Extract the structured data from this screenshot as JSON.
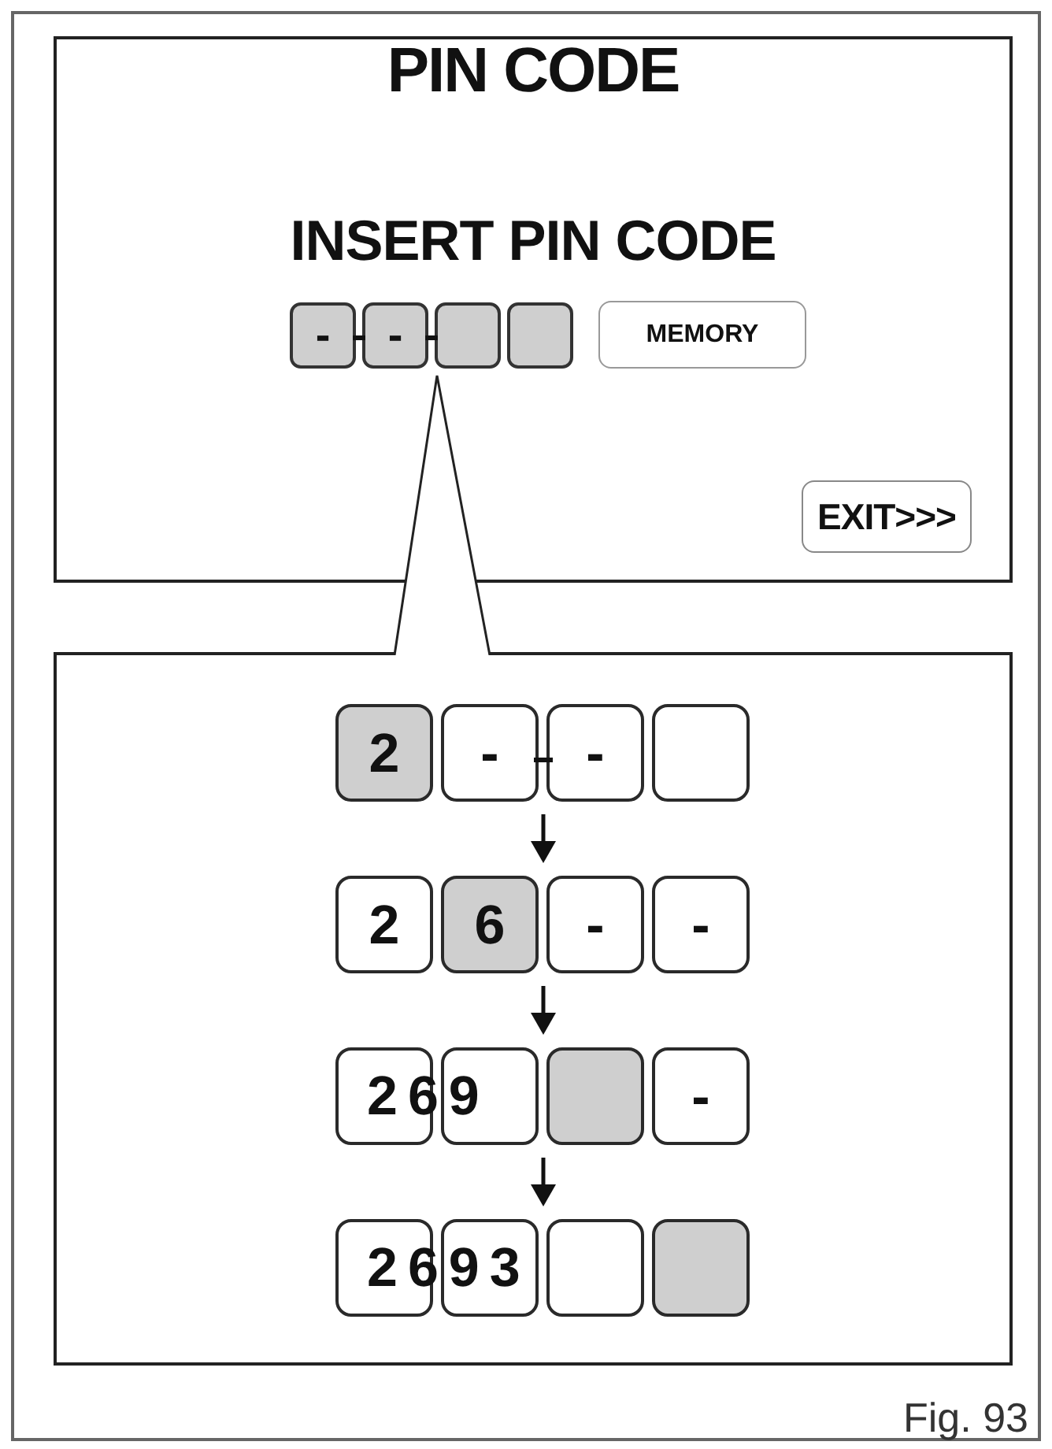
{
  "screen": {
    "title": "PIN CODE",
    "prompt": "INSERT PIN CODE",
    "pin_boxes": [
      {
        "text": "-",
        "selected": true,
        "tick_after": true
      },
      {
        "text": "-",
        "selected": true,
        "tick_after": true
      },
      {
        "selected": true,
        "tick_after": false
      },
      {
        "selected": true,
        "tick_after": false
      }
    ],
    "memory_button": "MEMORY",
    "exit_button": "EXIT>>>"
  },
  "steps": [
    {
      "boxes": [
        {
          "text": "2",
          "selected": true,
          "tick_after": false
        },
        {
          "text": "-",
          "selected": false,
          "tick_after": true
        },
        {
          "text": "-",
          "selected": false,
          "tick_after": false
        },
        {
          "selected": false,
          "tick_after": false
        }
      ]
    },
    {
      "boxes": [
        {
          "text": "2",
          "selected": false,
          "tick_after": false
        },
        {
          "text": "6",
          "selected": true,
          "tick_after": false
        },
        {
          "text": "-",
          "selected": false,
          "tick_after": false
        },
        {
          "text": "-",
          "selected": false,
          "tick_after": false
        }
      ]
    },
    {
      "readout": "269",
      "boxes": [
        {
          "selected": false,
          "tick_after": false
        },
        {
          "selected": false,
          "tick_after": false
        },
        {
          "selected": true,
          "tick_after": false
        },
        {
          "text": "-",
          "selected": false,
          "tick_after": false
        }
      ]
    },
    {
      "readout": "2693",
      "boxes": [
        {
          "selected": false,
          "tick_after": false
        },
        {
          "selected": false,
          "tick_after": false
        },
        {
          "selected": false,
          "tick_after": false
        },
        {
          "selected": true,
          "tick_after": false
        }
      ]
    }
  ],
  "figure_label": "Fig. 93"
}
